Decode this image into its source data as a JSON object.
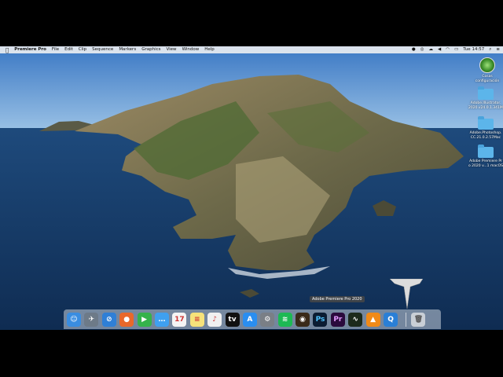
{
  "menubar": {
    "app_name": "Premiere Pro",
    "menus": [
      "File",
      "Edit",
      "Clip",
      "Sequence",
      "Markers",
      "Graphics",
      "View",
      "Window",
      "Help"
    ],
    "clock": "Tue 14:57"
  },
  "desktop": {
    "items": [
      {
        "label": "Cosas\nconfiguración",
        "icon": "disk-icon"
      },
      {
        "label": "Adobe.Illustrator.\n2020.v24.0.1.341Mac",
        "icon": "folder-icon"
      },
      {
        "label": "Adobe.Photoshop.\nCC.21.0.2.57Mac",
        "icon": "folder-icon"
      },
      {
        "label": "Adobe Premiere Pr\no 2020 v...1 macOS",
        "icon": "folder-icon"
      }
    ]
  },
  "dock": {
    "tooltip": "Adobe Premiere Pro 2020",
    "apps": [
      {
        "name": "finder-icon",
        "color": "#3a8de0",
        "glyph": "☺"
      },
      {
        "name": "launchpad-icon",
        "color": "#6d7a88",
        "glyph": "✈"
      },
      {
        "name": "safari-icon",
        "color": "#2f7fd6",
        "glyph": "⊘"
      },
      {
        "name": "firefox-icon",
        "color": "#e9682a",
        "glyph": "●"
      },
      {
        "name": "facetime-icon",
        "color": "#35b24b",
        "glyph": "▶"
      },
      {
        "name": "messages-icon",
        "color": "#3fa0f0",
        "glyph": "…"
      },
      {
        "name": "calendar-icon",
        "color": "#f4f4f4",
        "glyph": "17"
      },
      {
        "name": "notes-icon",
        "color": "#f6e27a",
        "glyph": "≡"
      },
      {
        "name": "music-icon",
        "color": "#f0f0f0",
        "glyph": "♪"
      },
      {
        "name": "appletv-icon",
        "color": "#111111",
        "glyph": "tv"
      },
      {
        "name": "appstore-icon",
        "color": "#2a8ef0",
        "glyph": "A"
      },
      {
        "name": "system-preferences-icon",
        "color": "#7a7f86",
        "glyph": "⚙"
      },
      {
        "name": "spotify-icon",
        "color": "#1db954",
        "glyph": "≋"
      },
      {
        "name": "speaker-app-icon",
        "color": "#3a2a1a",
        "glyph": "◉"
      },
      {
        "name": "photoshop-icon",
        "color": "#0b1c33",
        "glyph": "Ps"
      },
      {
        "name": "premiere-icon",
        "color": "#2b0a3d",
        "glyph": "Pr"
      },
      {
        "name": "activity-monitor-icon",
        "color": "#1c2a1c",
        "glyph": "∿"
      },
      {
        "name": "vlc-icon",
        "color": "#f08a18",
        "glyph": "▲"
      },
      {
        "name": "quicktime-icon",
        "color": "#2a7fd6",
        "glyph": "Q"
      }
    ],
    "trash": {
      "name": "trash-icon",
      "color": "#c9cfd6",
      "glyph": "🗑"
    },
    "calendar_day": "17"
  }
}
